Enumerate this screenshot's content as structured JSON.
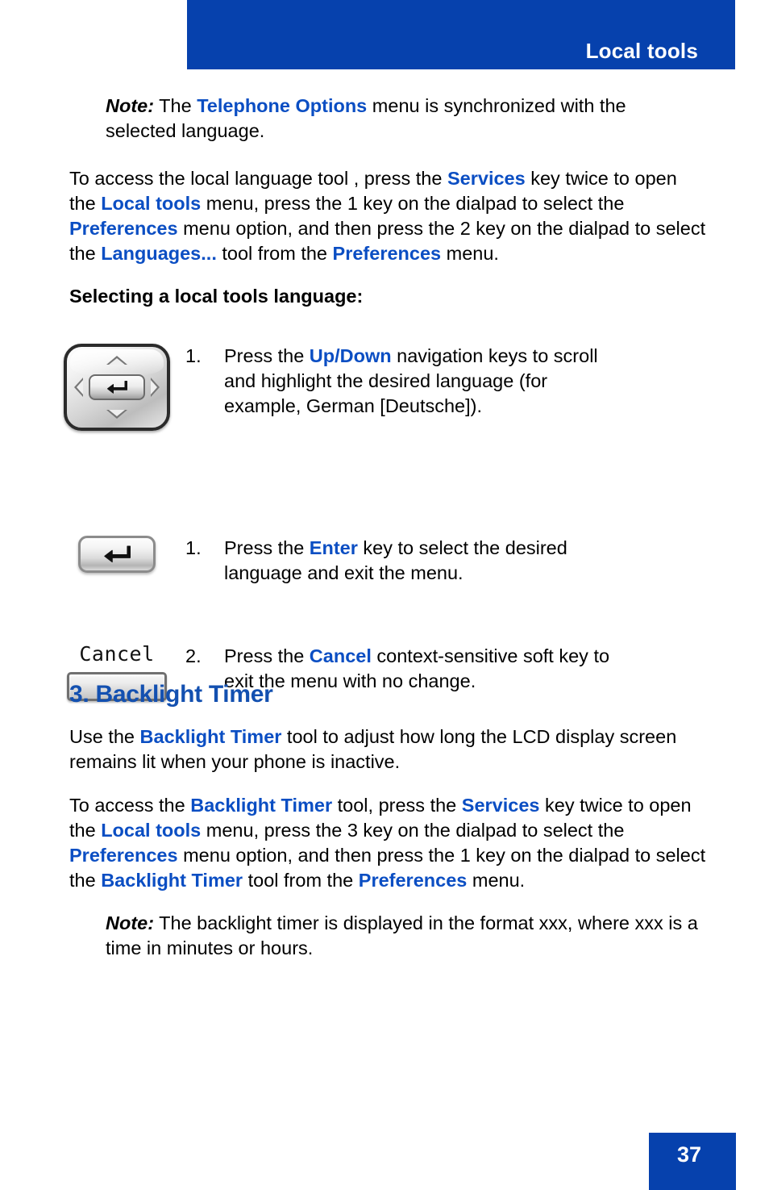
{
  "header": {
    "title": "Local tools",
    "bg_color": "#0641AD"
  },
  "note_top": {
    "label": "Note:",
    "text_1": " The ",
    "emph_1": "Telephone Options",
    "text_2": " menu is synchronized with the selected language."
  },
  "access_para": {
    "t1": "To access the local language tool , press the ",
    "e1": "Services",
    "t2": " key twice to open the ",
    "e2": "Local tools",
    "t3": " menu, press the 1 key on the dialpad to select the ",
    "e3": "Preferences",
    "t4": " menu option, and then press the 2 key on the dialpad to select the ",
    "e4": "Languages...",
    "t5": " tool from the ",
    "e5": "Preferences",
    "t6": " menu."
  },
  "subheading": "Selecting a local tools language:",
  "steps": [
    {
      "number": "1.",
      "art": "navigation-keys",
      "t1": "Press the ",
      "e1": "Up/Down",
      "t2": " navigation keys to scroll and highlight the desired language (for example, German [Deutsche])."
    },
    {
      "number": "1.",
      "art": "enter-key",
      "t1": "Press the ",
      "e1": "Enter",
      "t2": " key to select the desired language and exit the menu."
    },
    {
      "number": "2.",
      "art": "cancel-soft-key",
      "art_label": "Cancel",
      "t1": "Press the ",
      "e1": "Cancel",
      "t2": " context-sensitive soft key to exit the menu with no change."
    }
  ],
  "section": {
    "heading": "3. Backlight Timer",
    "heading_color": "#1350B0",
    "intro": {
      "t1": "Use the ",
      "e1": "Backlight Timer",
      "t2": " tool to adjust how long the LCD display screen remains lit when your phone is inactive."
    },
    "access": {
      "t1": "To access the ",
      "e1": "Backlight Timer",
      "t2": " tool, press the ",
      "e2": "Services",
      "t3": " key twice to open the ",
      "e3": "Local tools",
      "t4": " menu, press the 3 key on the dialpad to select the ",
      "e4": "Preferences",
      "t5": " menu option, and then press the 1 key on the dialpad to select the ",
      "e5": "Backlight Timer",
      "t6": " tool from the ",
      "e6": "Preferences",
      "t7": " menu."
    },
    "note": {
      "label": "Note:",
      "text": " The backlight timer is displayed in the format xxx, where xxx is a time in minutes or hours."
    }
  },
  "footer": {
    "page_number": "37",
    "bg_color": "#0641AD"
  }
}
